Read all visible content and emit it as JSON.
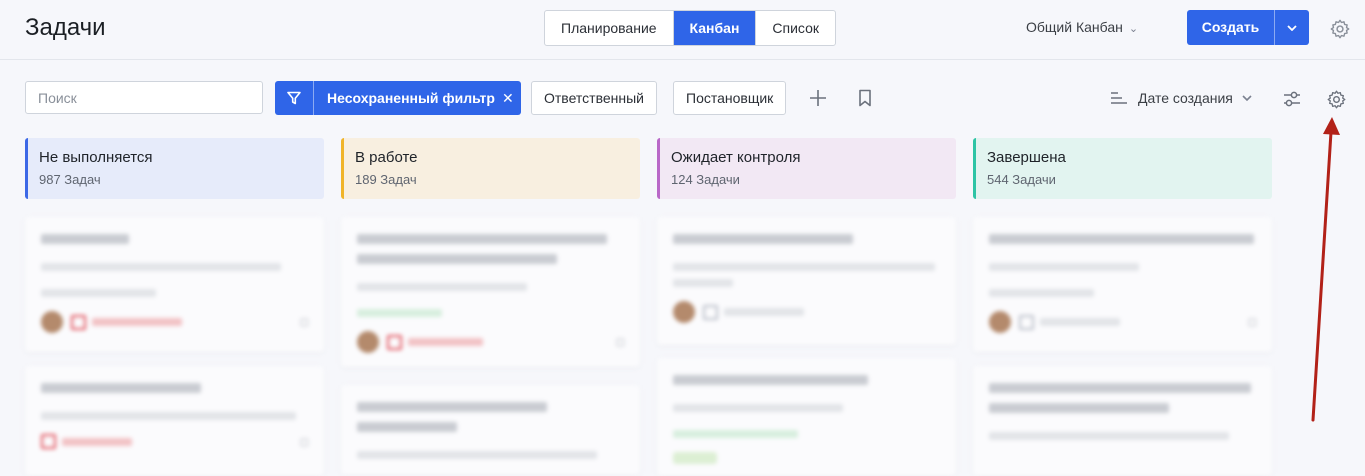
{
  "header": {
    "title": "Задачи",
    "views": [
      "Планирование",
      "Канбан",
      "Список"
    ],
    "active_view": "Канбан",
    "board_select": "Общий Канбан",
    "create_label": "Создать"
  },
  "filters": {
    "search_placeholder": "Поиск",
    "active_filter": "Несохраненный фильтр",
    "responsible": "Ответственный",
    "assigner": "Постановщик",
    "sort_label": "Дате создания"
  },
  "columns": [
    {
      "title": "Не выполняется",
      "count": "987 Задач",
      "bg": "#e6ebfa",
      "accent": "#3c68e6"
    },
    {
      "title": "В работе",
      "count": "189 Задач",
      "bg": "#f8efe0",
      "accent": "#f0b429"
    },
    {
      "title": "Ожидает контроля",
      "count": "124 Задачи",
      "bg": "#f2e8f4",
      "accent": "#b968c8"
    },
    {
      "title": "Завершена",
      "count": "544 Задачи",
      "bg": "#e2f4f0",
      "accent": "#2ec4a5"
    }
  ],
  "colors": {
    "primary": "#2f65e8",
    "annotation_arrow": "#b22118"
  },
  "icons": {
    "settings": "gear-icon",
    "filter": "funnel-icon",
    "add": "plus-icon",
    "bookmark": "bookmark-icon",
    "sort": "sort-lines-icon",
    "view_settings": "sliders-icon"
  }
}
